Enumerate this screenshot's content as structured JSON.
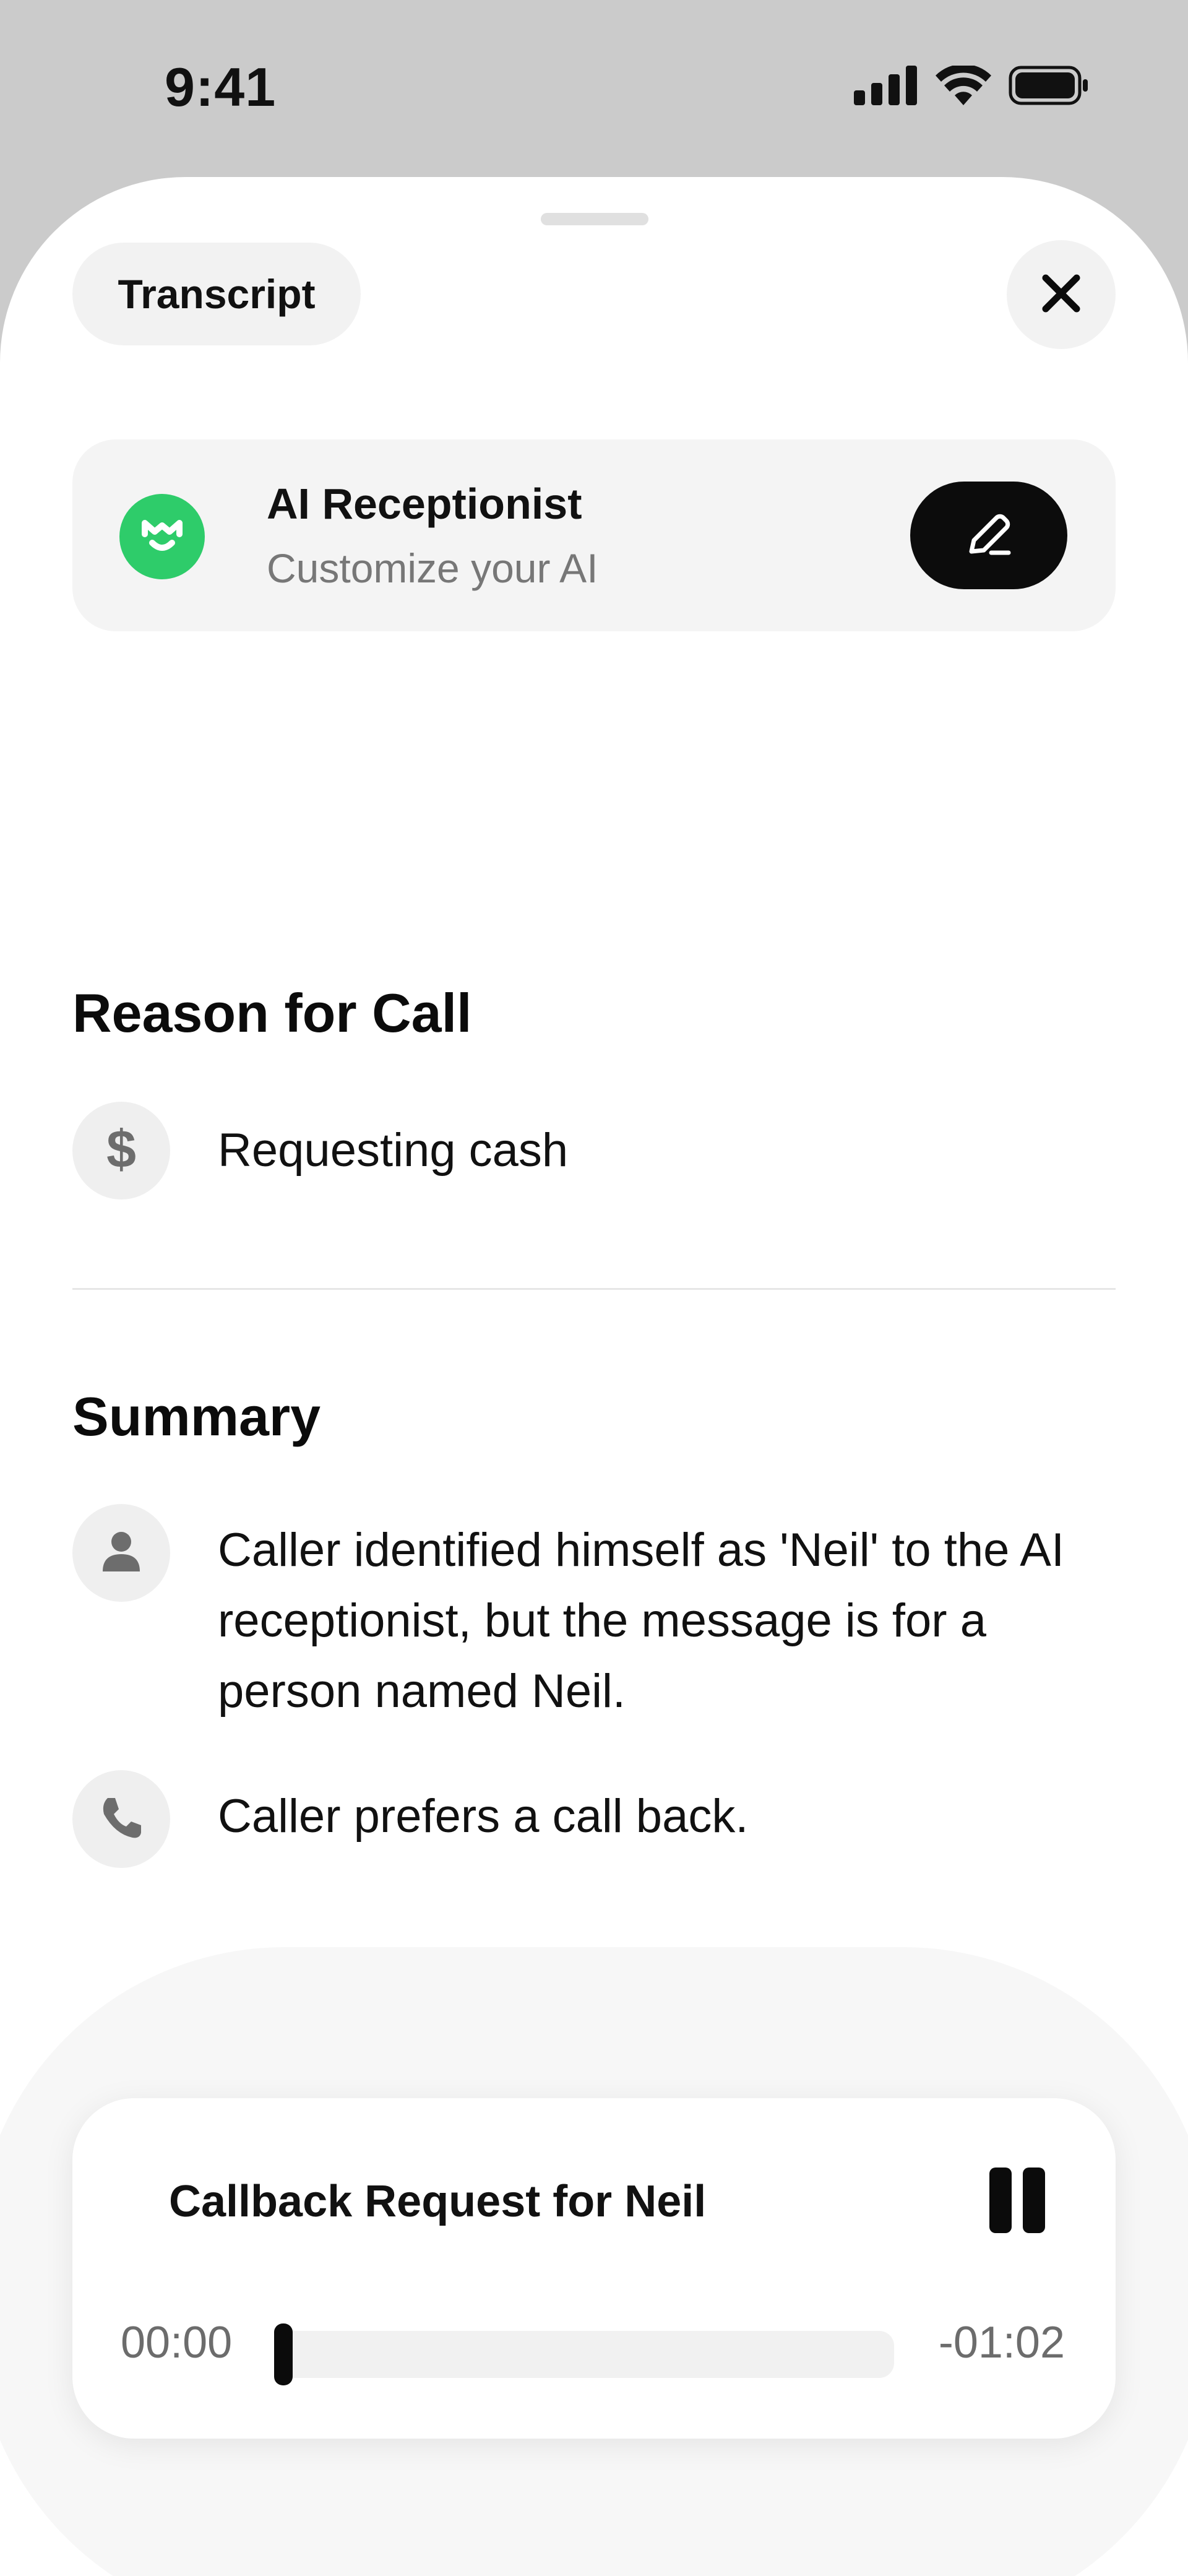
{
  "status_bar": {
    "time": "9:41",
    "icons": [
      "cellular-signal-icon",
      "wifi-icon",
      "battery-icon"
    ]
  },
  "header": {
    "tab_label": "Transcript",
    "close_icon": "close-icon"
  },
  "ai_card": {
    "title": "AI Receptionist",
    "subtitle": "Customize your AI",
    "logo_color": "#2ecc6a",
    "edit_icon": "pencil-icon"
  },
  "reason": {
    "heading": "Reason for Call",
    "items": [
      {
        "icon": "dollar-icon",
        "text": "Requesting cash"
      }
    ]
  },
  "summary": {
    "heading": "Summary",
    "items": [
      {
        "icon": "person-icon",
        "text": "Caller identified himself as 'Neil' to the AI receptionist, but the message is for a person named Neil."
      },
      {
        "icon": "phone-icon",
        "text": "Caller prefers a call back."
      }
    ]
  },
  "player": {
    "title": "Callback Request for Neil",
    "elapsed": "00:00",
    "remaining": "-01:02",
    "progress": 0,
    "state_icon": "pause-icon"
  }
}
